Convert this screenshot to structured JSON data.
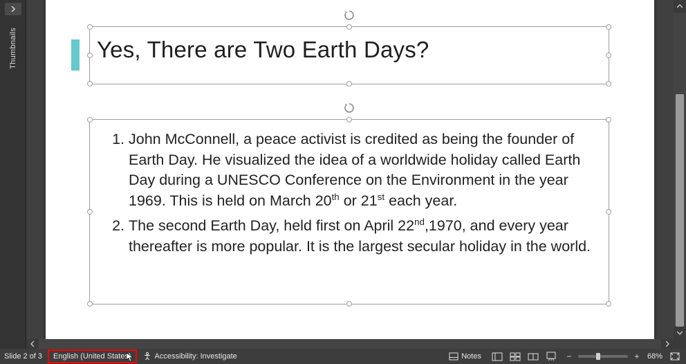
{
  "thumbnails": {
    "label": "Thumbnails"
  },
  "slide": {
    "title": "Yes, There are Two Earth Days?",
    "item1": {
      "part_a": "John McConnell, a peace activist is credited as being the founder of Earth Day. He visualized the idea of a worldwide holiday called Earth Day during a UNESCO Conference on the Environment in the year 1969. This is held on March 20",
      "sup_a": "th",
      "part_b": " or 21",
      "sup_b": "st",
      "part_c": " each year."
    },
    "item2": {
      "part_a": "The second Earth Day, held first on April 22",
      "sup_a": "nd",
      "part_b": ",1970, and every year thereafter is more popular. It is the largest secular holiday in the world."
    }
  },
  "statusbar": {
    "slide_counter": "Slide 2 of 3",
    "language": "English (United States)",
    "accessibility": "Accessibility: Investigate",
    "notes": "Notes",
    "zoom_pct": "68%"
  }
}
